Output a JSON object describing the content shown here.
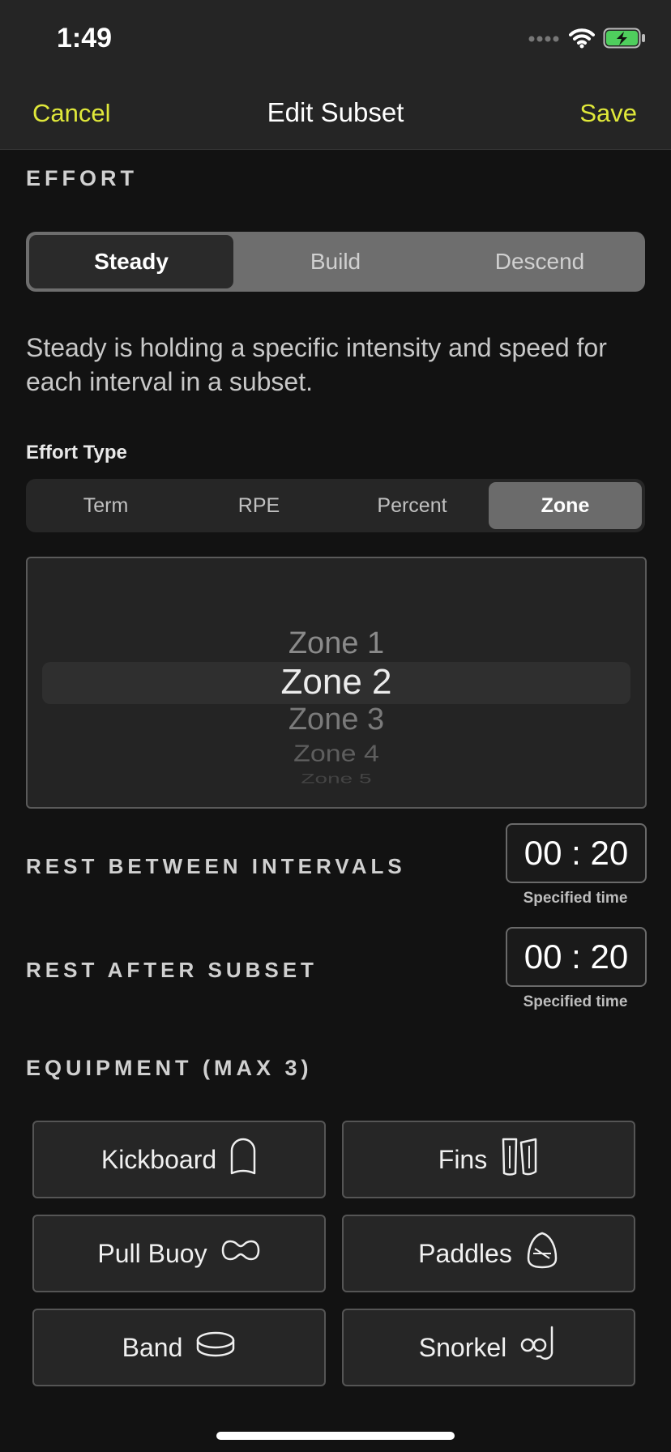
{
  "status_bar": {
    "time": "1:49",
    "icons": [
      "signal-icon",
      "wifi-icon",
      "battery-charging-icon"
    ],
    "battery_color": "#4fce5d"
  },
  "nav": {
    "cancel_label": "Cancel",
    "title": "Edit Subset",
    "save_label": "Save",
    "accent_color": "#e0e83a"
  },
  "effort": {
    "section_title": "EFFORT",
    "options": [
      "Steady",
      "Build",
      "Descend"
    ],
    "selected": "Steady",
    "description": "Steady is holding a specific intensity and speed for each interval in a subset."
  },
  "effort_type": {
    "label": "Effort Type",
    "options": [
      "Term",
      "RPE",
      "Percent",
      "Zone"
    ],
    "selected": "Zone"
  },
  "zone_picker": {
    "items": [
      "Zone 1",
      "Zone 2",
      "Zone 3",
      "Zone 4",
      "Zone 5"
    ],
    "selected": "Zone 2"
  },
  "rest_between": {
    "label": "REST BETWEEN INTERVALS",
    "value": "00 : 20",
    "caption": "Specified time"
  },
  "rest_after": {
    "label": "REST AFTER SUBSET",
    "value": "00 : 20",
    "caption": "Specified time"
  },
  "equipment": {
    "section_title": "EQUIPMENT (MAX 3)",
    "items": [
      {
        "label": "Kickboard",
        "icon": "kickboard-icon"
      },
      {
        "label": "Fins",
        "icon": "fins-icon"
      },
      {
        "label": "Pull Buoy",
        "icon": "pull-buoy-icon"
      },
      {
        "label": "Paddles",
        "icon": "paddles-icon"
      },
      {
        "label": "Band",
        "icon": "band-icon"
      },
      {
        "label": "Snorkel",
        "icon": "snorkel-icon"
      }
    ]
  }
}
